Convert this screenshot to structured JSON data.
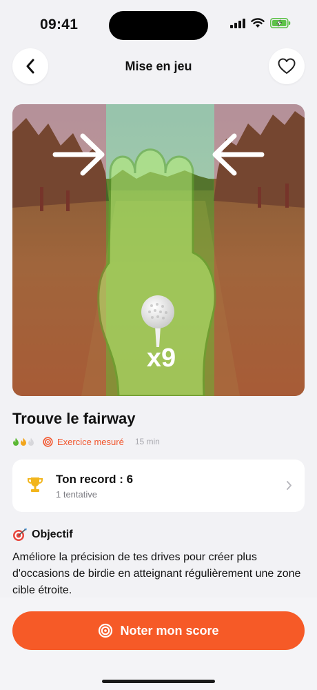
{
  "status": {
    "time": "09:41"
  },
  "header": {
    "title": "Mise en jeu"
  },
  "hero": {
    "multiplier": "x9"
  },
  "exercise": {
    "title": "Trouve le fairway",
    "difficulty": 2,
    "difficulty_max": 3,
    "type_label": "Exercice mesuré",
    "duration": "15 min"
  },
  "record": {
    "title": "Ton record : 6",
    "subtitle": "1 tentative"
  },
  "objective": {
    "heading": "Objectif",
    "text": "Améliore la précision de tes drives pour créer plus d'occasions de birdie en atteignant régulièrement une zone cible étroite."
  },
  "cta": {
    "label": "Noter mon score"
  },
  "colors": {
    "accent": "#f65a27",
    "trophy": "#f2b51c",
    "flame_green": "#5bb834",
    "flame_orange": "#f2a51c"
  }
}
